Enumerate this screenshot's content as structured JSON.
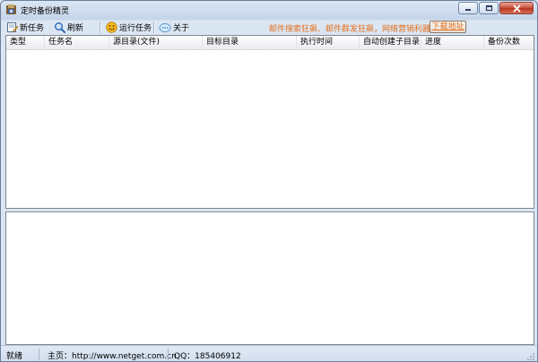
{
  "window": {
    "title": "定时备份精灵"
  },
  "toolbar": {
    "new_task": "新任务",
    "refresh": "刷新",
    "run_task": "运行任务",
    "about": "关于",
    "promo": "邮件搜索狂飙、邮件群发狂飙，网络营销利器",
    "download": "下载地址"
  },
  "table": {
    "columns": [
      "类型",
      "任务名",
      "源目录(文件)",
      "目标目录",
      "执行时间",
      "自动创建子目录",
      "进度",
      "备份次数"
    ]
  },
  "statusbar": {
    "status": "就绪",
    "homepage": "主页：http://www.netget.com.cn",
    "qq": "QQ：185406912"
  },
  "colors": {
    "accent_orange": "#e46f1d",
    "close_red": "#c74a35",
    "frame_blue": "#dbe6f4"
  },
  "icons": {
    "app": "backup-app-icon",
    "new_task": "new-task-icon",
    "refresh": "search-refresh-icon",
    "run_task": "smiley-run-icon",
    "about": "about-info-icon"
  }
}
